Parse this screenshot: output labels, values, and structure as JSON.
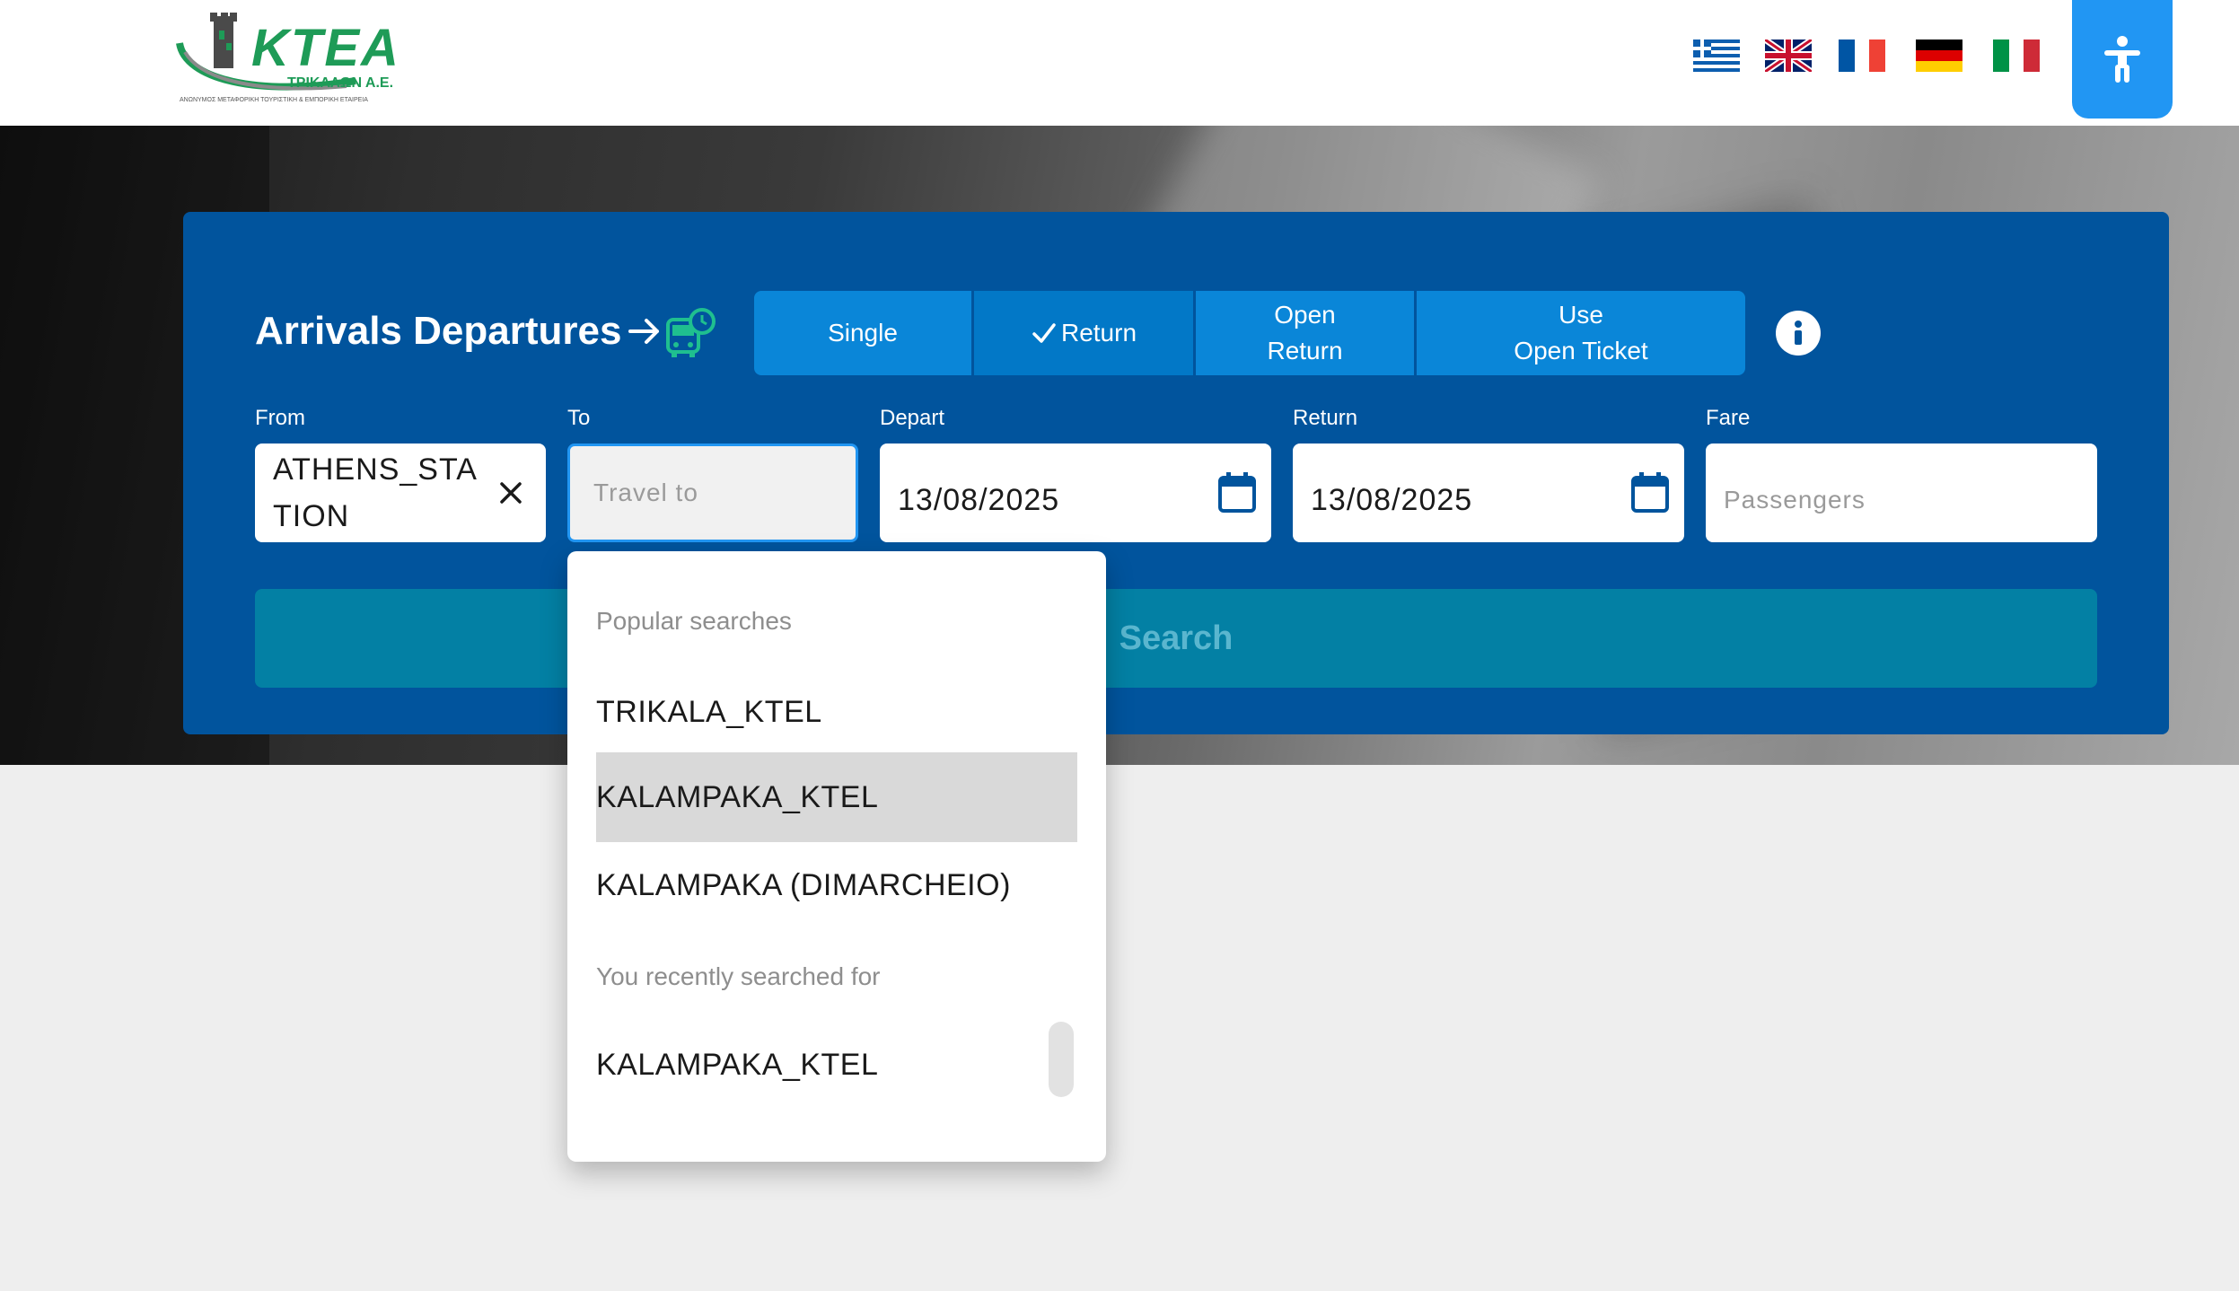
{
  "header": {
    "logo_text": "KTEA",
    "logo_subtitle": "ΤΡΙΚΑΛΩΝ Α.Ε.",
    "logo_tagline": "ΑΝΩΝΥΜΟΣ ΜΕΤΑΦΟΡΙΚΗ ΤΟΥΡΙΣΤΙΚΗ & ΕΜΠΟΡΙΚΗ ΕΤΑΙΡΕΙΑ",
    "languages": [
      "greek-flag-icon",
      "uk-flag-icon",
      "french-flag-icon",
      "german-flag-icon",
      "italian-flag-icon"
    ],
    "accessibility_icon": "accessibility-icon"
  },
  "booking": {
    "title": "Arrivals Departures",
    "trip_types": [
      {
        "label": "Single",
        "active": false
      },
      {
        "label": "Return",
        "active": true
      },
      {
        "label": "Open\nReturn",
        "active": false
      },
      {
        "label": "Use\nOpen Ticket",
        "active": false
      }
    ],
    "from": {
      "label": "From",
      "value": "ATHENS_STA\nTION"
    },
    "to": {
      "label": "To",
      "placeholder": "Travel to"
    },
    "depart": {
      "label": "Depart",
      "value": "13/08/2025"
    },
    "return": {
      "label": "Return",
      "value": "13/08/2025"
    },
    "fare": {
      "label": "Fare",
      "placeholder": "Passengers"
    },
    "search_label": "Search"
  },
  "dropdown": {
    "popular_heading": "Popular searches",
    "popular": [
      "TRIKALA_KTEL",
      "KALAMPAKA_KTEL",
      "KALAMPAKA (DIMARCHEIO)"
    ],
    "recent_heading": "You recently searched for",
    "recent": [
      "KALAMPAKA_KTEL"
    ]
  },
  "colors": {
    "panel": "#01549d",
    "tab": "#0a86d8",
    "search": "#0380a4",
    "accent": "#2196f3",
    "logo_green": "#1e9b57"
  }
}
